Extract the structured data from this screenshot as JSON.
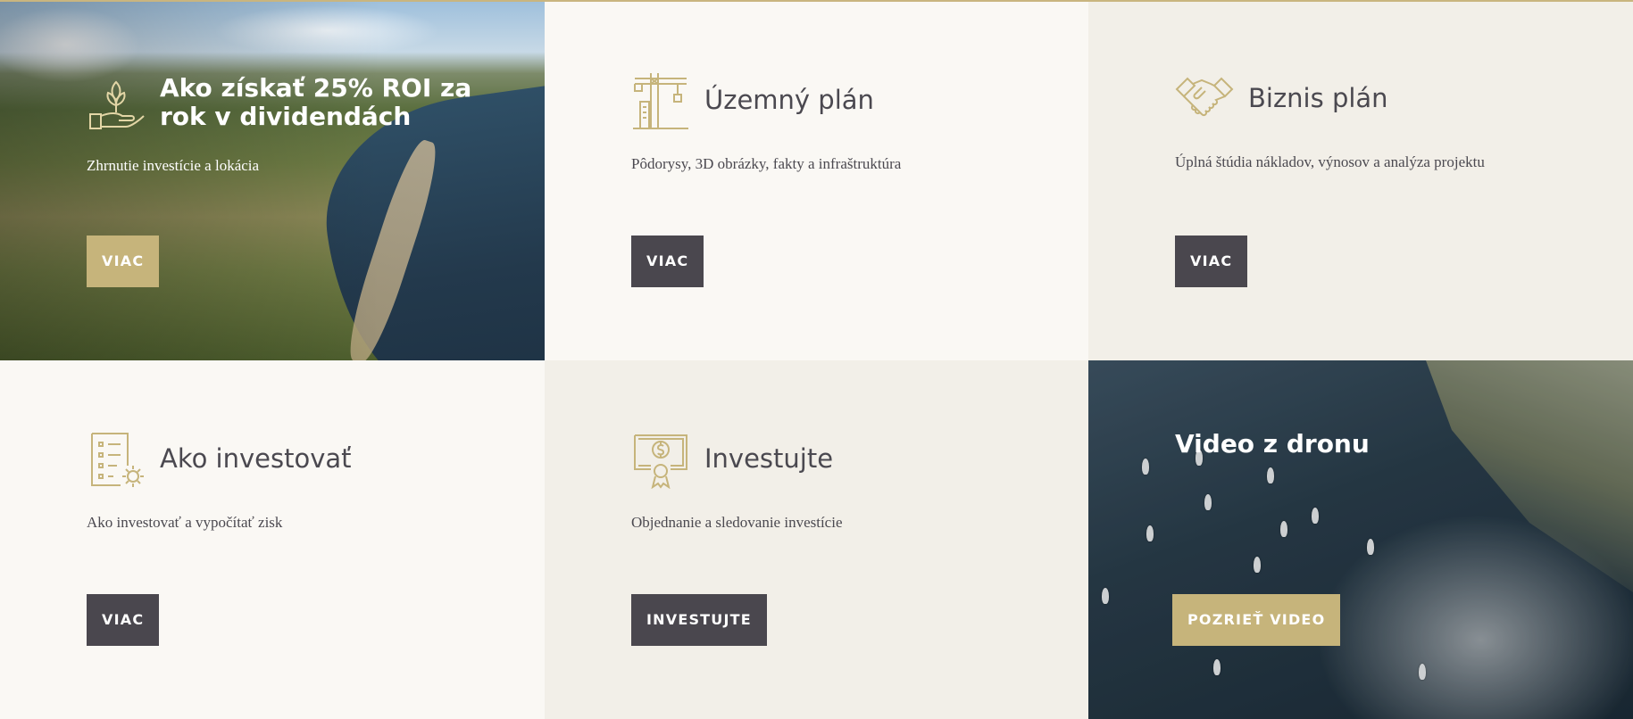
{
  "tiles": {
    "roi": {
      "title": "Ako získať 25% ROI za rok v dividendách",
      "description": "Zhrnutie investície a lokácia",
      "button": "VIAC",
      "icon": "hand-sprout-icon"
    },
    "zoning": {
      "title": "Územný plán",
      "description": "Pôdorysy, 3D obrázky, fakty a infraštruktúra",
      "button": "VIAC",
      "icon": "crane-building-icon"
    },
    "business": {
      "title": "Biznis plán",
      "description": "Úplná štúdia nákladov, výnosov a analýza projektu",
      "button": "VIAC",
      "icon": "handshake-icon"
    },
    "howto": {
      "title": "Ako investovať",
      "description": "Ako investovať a vypočítať zisk",
      "button": "VIAC",
      "icon": "checklist-gear-icon"
    },
    "invest": {
      "title": "Investujte",
      "description": "Objednanie a sledovanie investície",
      "button": "INVESTUJTE",
      "icon": "certificate-icon"
    },
    "video": {
      "title": "Video z dronu",
      "button": "POZRIEŤ VIDEO"
    }
  },
  "colors": {
    "gold": "#c6b47b",
    "dark_button": "#4a474e",
    "text": "#4b4950",
    "light_bg": "#faf8f4",
    "beige_bg": "#f2efe8"
  }
}
